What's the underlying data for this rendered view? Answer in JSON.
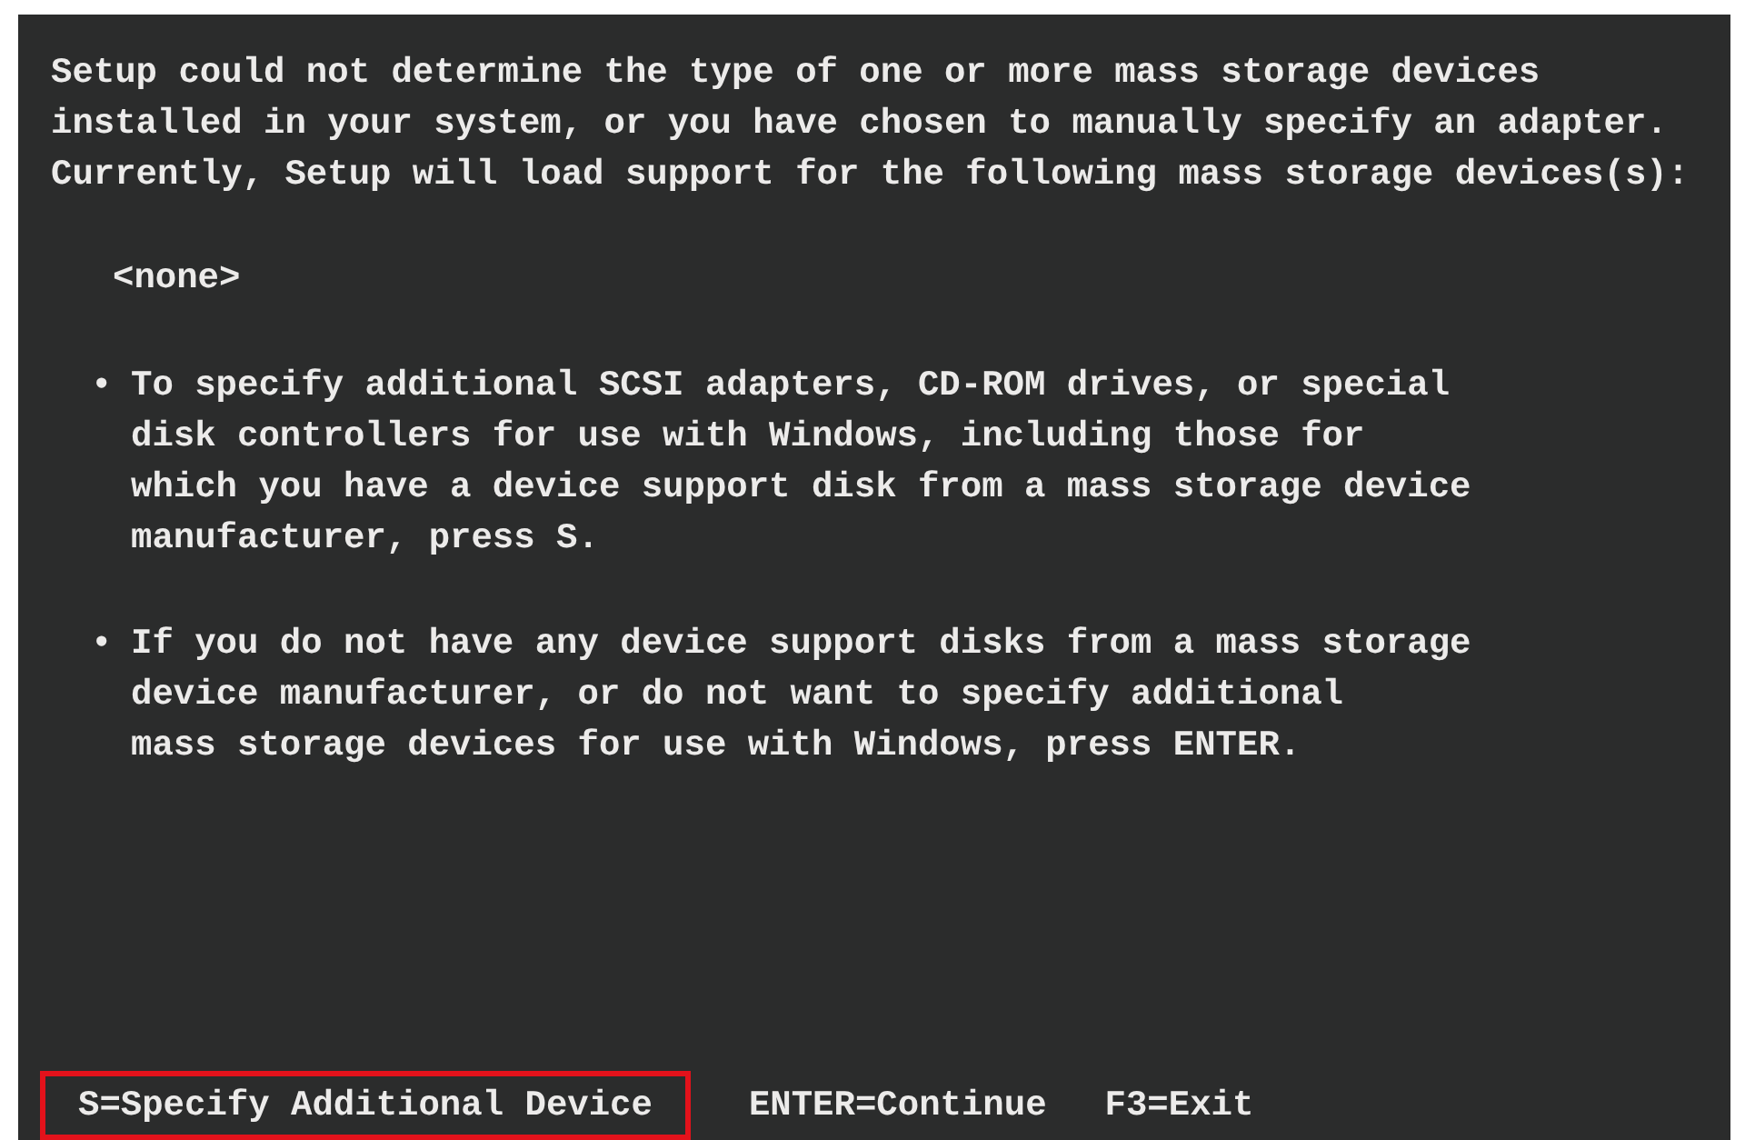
{
  "intro": "Setup could not determine the type of one or more mass storage devices\ninstalled in your system, or you have chosen to manually specify an adapter.\nCurrently, Setup will load support for the following mass storage devices(s):",
  "devices": [
    "<none>"
  ],
  "bullets": [
    {
      "bullet": "•",
      "text": "To specify additional SCSI adapters, CD-ROM drives, or special\ndisk controllers for use with Windows, including those for\nwhich you have a device support disk from a mass storage device\nmanufacturer, press S."
    },
    {
      "bullet": "•",
      "text": "If you do not have any device support disks from a mass storage\ndevice manufacturer, or do not want to specify additional\nmass storage devices for use with Windows, press ENTER."
    }
  ],
  "status_bar": [
    {
      "text": "S=Specify Additional Device",
      "highlighted": true
    },
    {
      "text": "ENTER=Continue",
      "highlighted": false
    },
    {
      "text": "F3=Exit",
      "highlighted": false
    }
  ]
}
